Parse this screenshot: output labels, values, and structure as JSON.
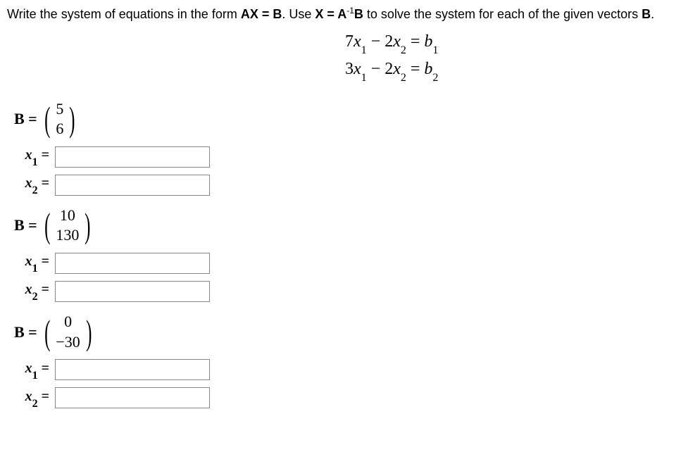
{
  "instruction": {
    "pre": "Write the system of equations in the form ",
    "ax_eq_b": "AX = B",
    "mid": ". Use ",
    "x_eq": "X = A",
    "inv": "-1",
    "b_label": "B",
    "post": " to solve the system for each of the given vectors ",
    "b_end": "B",
    "period": "."
  },
  "equations": {
    "line1_lhs": "7",
    "line1_var1": "x",
    "line1_sub1": "1",
    "line1_mid": " − 2",
    "line1_var2": "x",
    "line1_sub2": "2",
    "line1_eq": " = ",
    "line1_rhs": "b",
    "line1_rsub": "1",
    "line2_lhs": "3",
    "line2_var1": "x",
    "line2_sub1": "1",
    "line2_mid": " − 2",
    "line2_var2": "x",
    "line2_sub2": "2",
    "line2_eq": " = ",
    "line2_rhs": "b",
    "line2_rsub": "2"
  },
  "problems": [
    {
      "b_label": "B =",
      "v1": "5",
      "v2": "6",
      "x1_label": "x1 =",
      "x2_label": "x2 ="
    },
    {
      "b_label": "B =",
      "v1": "10",
      "v2": "130",
      "x1_label": "x1 =",
      "x2_label": "x2 ="
    },
    {
      "b_label": "B =",
      "v1": "0",
      "v2": "−30",
      "x1_label": "x1 =",
      "x2_label": "x2 ="
    }
  ]
}
